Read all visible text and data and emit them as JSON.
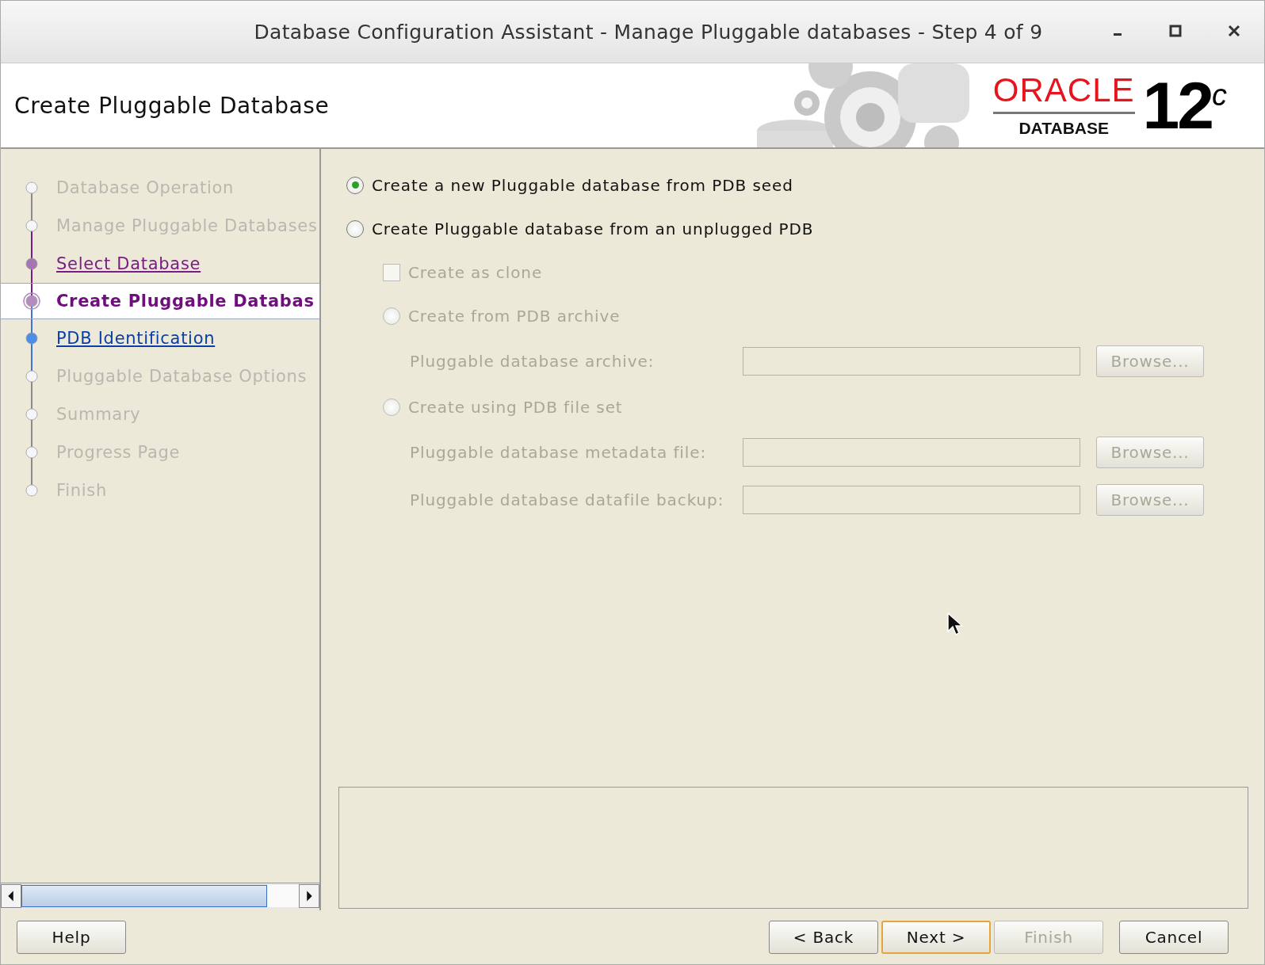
{
  "window": {
    "title": "Database Configuration Assistant - Manage Pluggable databases - Step 4 of 9"
  },
  "header": {
    "title": "Create Pluggable Database",
    "logo": {
      "brand": "ORACLE",
      "product": "DATABASE",
      "version": "12$^{c}$"
    }
  },
  "steps": [
    {
      "label": "Database Operation",
      "kind": "pending"
    },
    {
      "label": "Manage Pluggable Databases",
      "kind": "pending"
    },
    {
      "label": "Select Database",
      "kind": "done"
    },
    {
      "label": "Create Pluggable Databas",
      "kind": "current"
    },
    {
      "label": "PDB Identification",
      "kind": "next"
    },
    {
      "label": "Pluggable Database Options",
      "kind": "pending"
    },
    {
      "label": "Summary",
      "kind": "pending"
    },
    {
      "label": "Progress Page",
      "kind": "pending"
    },
    {
      "label": "Finish",
      "kind": "pending"
    }
  ],
  "source_options": [
    {
      "label": "Create a new Pluggable database from PDB seed",
      "selected": true,
      "disabled": false
    },
    {
      "label": "Create Pluggable database from an unplugged PDB",
      "selected": false,
      "disabled": false
    }
  ],
  "clone": {
    "label": "Create as clone",
    "checked": false,
    "disabled": true
  },
  "methods": [
    {
      "label": "Create from PDB archive",
      "selected": false,
      "disabled": true,
      "fields": [
        {
          "label": "Pluggable database archive:",
          "button": "Browse...",
          "disabled": true
        }
      ]
    },
    {
      "label": "Create using PDB file set",
      "selected": false,
      "disabled": true,
      "fields": [
        {
          "label": "Pluggable database metadata file:",
          "button": "Browse...",
          "disabled": true
        },
        {
          "label": "Pluggable database datafile backup:",
          "button": "Browse...",
          "disabled": true
        }
      ]
    }
  ],
  "footer": {
    "help": {
      "label": "Help",
      "disabled": false,
      "focused": false
    },
    "buttons": [
      {
        "label": "< Back",
        "disabled": false,
        "focused": false
      },
      {
        "label": "Next >",
        "disabled": false,
        "focused": true
      },
      {
        "label": "Finish",
        "disabled": true,
        "focused": false
      },
      {
        "label": "Cancel",
        "disabled": false,
        "focused": false
      }
    ]
  }
}
